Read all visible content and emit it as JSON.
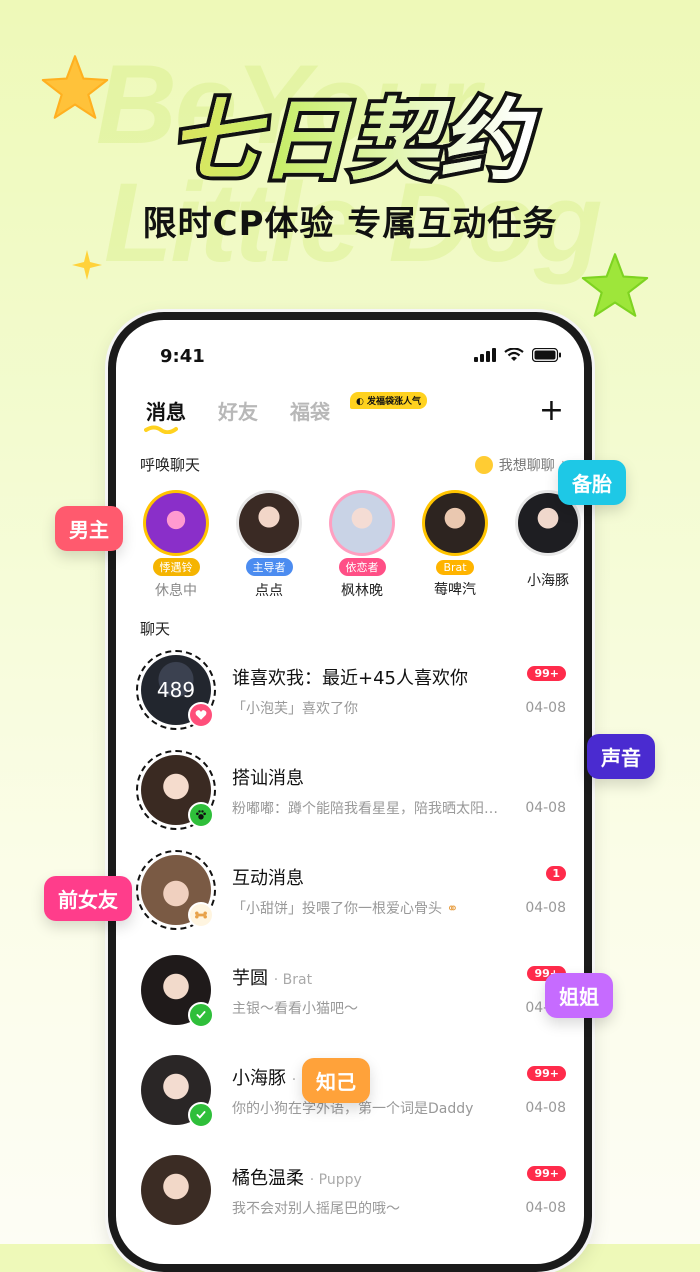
{
  "hero": {
    "title": "七日契约",
    "subtitle": "限时CP体验  专属互动任务",
    "bg_words": [
      "BeYour",
      "Little Dog"
    ]
  },
  "status_bar": {
    "time": "9:41"
  },
  "tabs": {
    "items": [
      {
        "label": "消息",
        "active": true
      },
      {
        "label": "好友",
        "active": false
      },
      {
        "label": "福袋",
        "active": false
      }
    ],
    "fudai_badge": "发福袋涨人气",
    "plus": "+"
  },
  "call_chat": {
    "label": "呼唤聊天",
    "want_chat": "我想聊聊",
    "want_chat_arrow": "›"
  },
  "stories": [
    {
      "tag": "悸遇铃",
      "tag_color": "#f5b400",
      "name": "休息中",
      "name_dim": true
    },
    {
      "tag": "主导者",
      "tag_color": "#4c8cf0",
      "name": "点点",
      "name_dim": false
    },
    {
      "tag": "依恋者",
      "tag_color": "#ff4f86",
      "name": "枫林晚",
      "name_dim": false
    },
    {
      "tag": "Brat",
      "tag_color": "#ffb400",
      "name": "莓啤汽",
      "name_dim": false
    },
    {
      "tag": "",
      "tag_color": "",
      "name": "小海豚",
      "name_dim": false
    }
  ],
  "chat_section_label": "聊天",
  "chats": [
    {
      "title": "谁喜欢我：最近+45人喜欢你",
      "sub": "",
      "preview": "「小泡芙」喜欢了你",
      "badge": "99+",
      "date": "04-08",
      "avatar_text": "489"
    },
    {
      "title": "搭讪消息",
      "sub": "",
      "preview": "粉嘟嘟：蹲个能陪我看星星，陪我晒太阳的人",
      "badge": "",
      "date": "04-08",
      "avatar_text": ""
    },
    {
      "title": "互动消息",
      "sub": "",
      "preview": "「小甜饼」投喂了你一根爱心骨头",
      "badge": "1",
      "date": "04-08",
      "avatar_text": ""
    },
    {
      "title": "芋圆",
      "sub": "· Brat",
      "preview": "主银～看看小猫吧～",
      "badge": "99+",
      "date": "04-08",
      "avatar_text": ""
    },
    {
      "title": "小海豚",
      "sub": "·",
      "preview": "你的小狗在学外语，第一个词是Daddy",
      "badge": "99+",
      "date": "04-08",
      "avatar_text": ""
    },
    {
      "title": "橘色温柔",
      "sub": "· Puppy",
      "preview": "我不会对别人摇尾巴的哦～",
      "badge": "99+",
      "date": "04-08",
      "avatar_text": ""
    }
  ],
  "float_tags": [
    {
      "label": "男主",
      "color": "#ff5a6e"
    },
    {
      "label": "备胎",
      "color": "#1ec8e6"
    },
    {
      "label": "声音",
      "color": "#4a2bd0"
    },
    {
      "label": "前女友",
      "color": "#ff3d8b"
    },
    {
      "label": "姐姐",
      "color": "#c66bff"
    },
    {
      "label": "知己",
      "color": "#ffa23a"
    }
  ]
}
